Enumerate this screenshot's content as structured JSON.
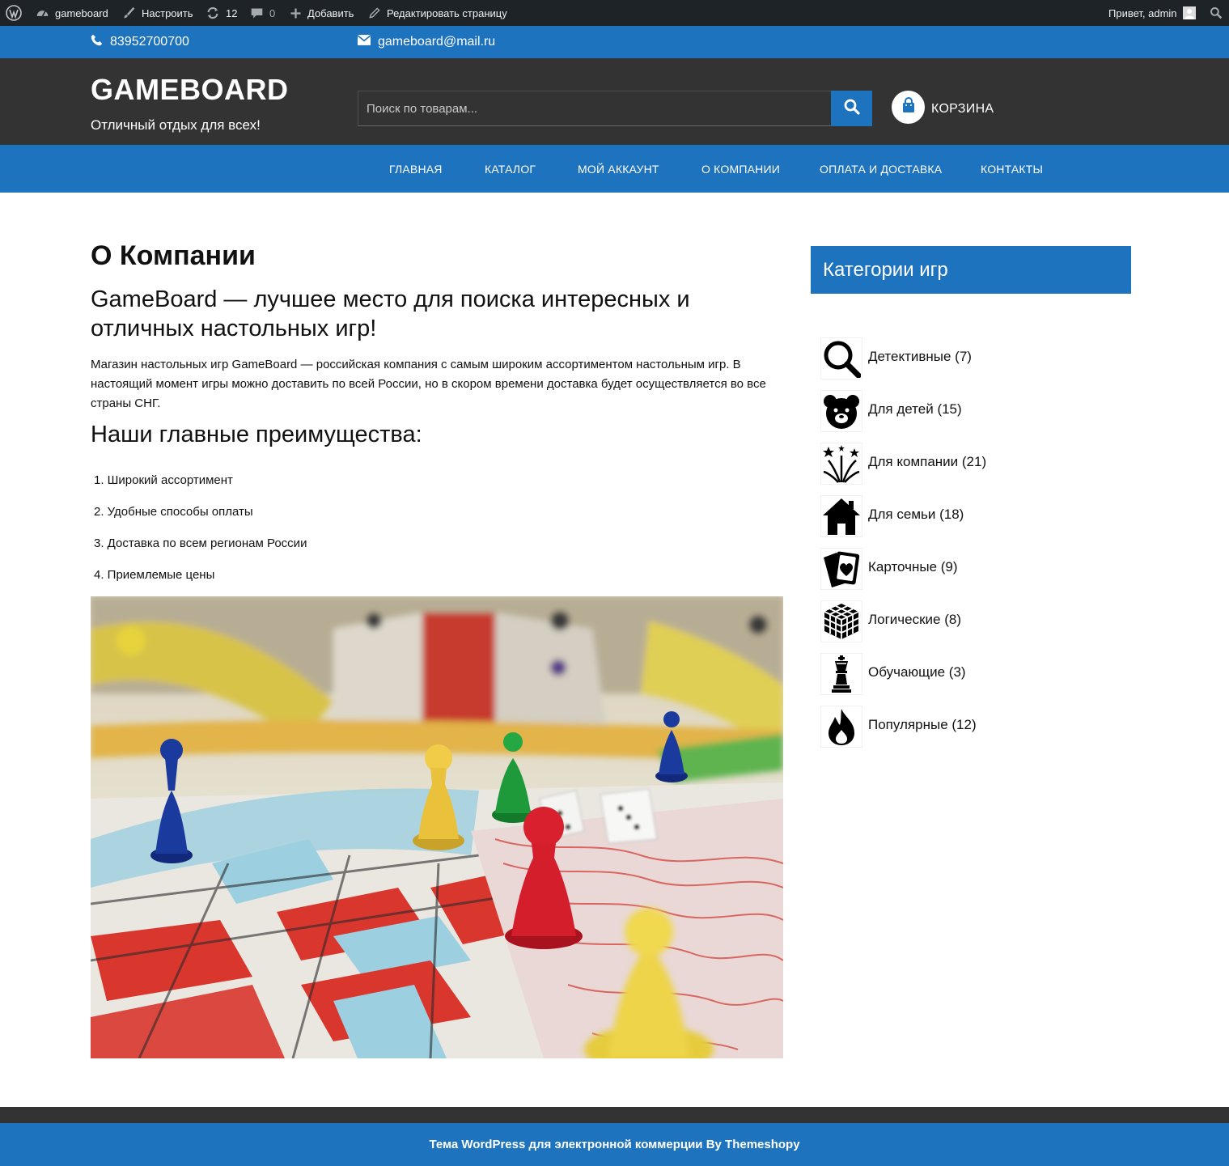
{
  "adminbar": {
    "site_name": "gameboard",
    "customize": "Настроить",
    "updates_count": "12",
    "comments_count": "0",
    "add_new": "Добавить",
    "edit_page": "Редактировать страницу",
    "greeting": "Привет, admin"
  },
  "contacts": {
    "phone": "83952700700",
    "email": "gameboard@mail.ru"
  },
  "header": {
    "title": "GAMEBOARD",
    "tagline": "Отличный отдых для всех!",
    "search_placeholder": "Поиск по товарам...",
    "cart_label": "КОРЗИНА"
  },
  "nav": {
    "items": [
      "ГЛАВНАЯ",
      "КАТАЛОГ",
      "МОЙ АККАУНТ",
      "О КОМПАНИИ",
      "ОПЛАТА И ДОСТАВКА",
      "КОНТАКТЫ"
    ]
  },
  "content": {
    "title": "О Компании",
    "lead": "GameBoard — лучшее место для поиска интересных и отличных настольных игр!",
    "intro": "Магазин настольных игр GameBoard — российская компания с самым широким ассортиментом настольным игр. В настоящий момент игры можно доставить по всей России, но в скором времени доставка будет осуществляется во все страны СНГ.",
    "advantages_title": "Наши главные преимущества:",
    "advantages": [
      "1. Широкий ассортимент",
      "2. Удобные способы оплаты",
      "3. Доставка по всем регионам России",
      "4. Приемлемые цены"
    ]
  },
  "sidebar": {
    "title": "Категории игр",
    "categories": [
      {
        "label": "Детективные (7)",
        "icon": "magnifier-icon"
      },
      {
        "label": "Для детей (15)",
        "icon": "teddy-bear-icon"
      },
      {
        "label": "Для компании (21)",
        "icon": "fireworks-icon"
      },
      {
        "label": "Для семьи (18)",
        "icon": "house-icon"
      },
      {
        "label": "Карточные (9)",
        "icon": "playing-cards-icon"
      },
      {
        "label": "Логические (8)",
        "icon": "rubik-cube-icon"
      },
      {
        "label": "Обучающие (3)",
        "icon": "chess-queen-icon"
      },
      {
        "label": "Популярные (12)",
        "icon": "flame-icon"
      }
    ]
  },
  "footer": {
    "credit": "Тема WordPress для электронной коммерции By Themeshopy"
  }
}
